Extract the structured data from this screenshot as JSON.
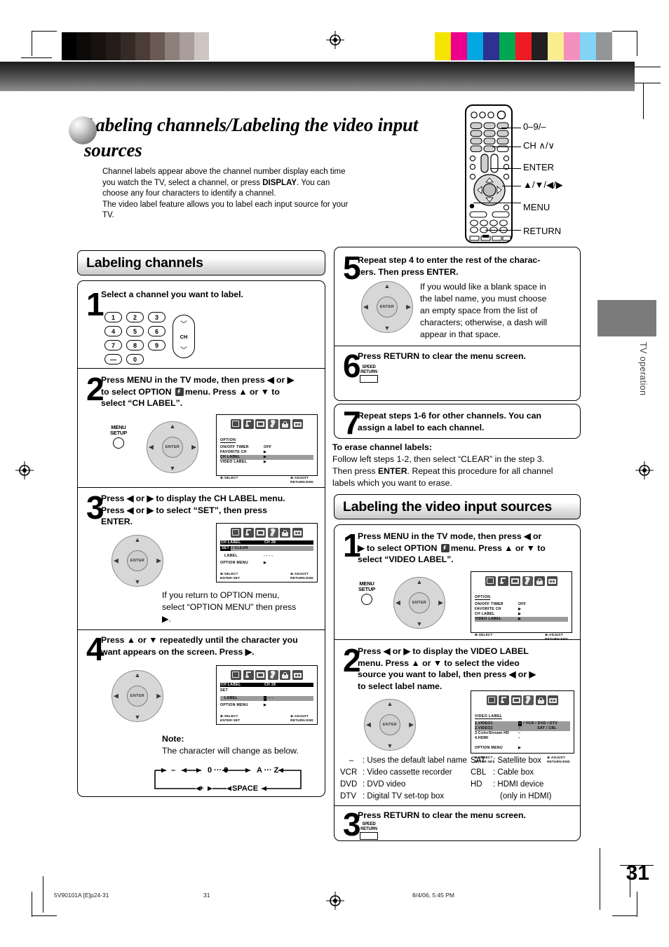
{
  "header": {
    "title": "Labeling channels/Labeling the video input sources",
    "intro_line1": "Channel labels appear above the channel number display each time",
    "intro_line2_a": "you watch the TV, select a channel, or press ",
    "intro_line2_b": "DISPLAY",
    "intro_line2_c": ". You can",
    "intro_line3": "choose any four characters to identify a channel.",
    "intro_line4": "The video label feature allows you to label each input source for your",
    "intro_line5": "TV."
  },
  "remote": {
    "callouts": [
      {
        "label": "0–9/–"
      },
      {
        "label": "CH  ∧/∨"
      },
      {
        "label": "ENTER"
      },
      {
        "label": "▲/▼/◀/▶"
      },
      {
        "label": "MENU"
      },
      {
        "label": "RETURN"
      }
    ]
  },
  "sections": {
    "labeling_channels": "Labeling channels",
    "labeling_video": "Labeling the video input sources"
  },
  "keypad": {
    "keys": [
      "1",
      "2",
      "3",
      "4",
      "5",
      "6",
      "7",
      "8",
      "9",
      "—",
      "0"
    ],
    "ch_label": "CH"
  },
  "buttons": {
    "menu_line1": "MENU",
    "menu_line2": "SETUP",
    "enter": "ENTER",
    "return_line1": "SPEED",
    "return_line2": "RETURN"
  },
  "steps_channels": [
    {
      "num": "1",
      "text": "Select a channel you want to label."
    },
    {
      "num": "2",
      "line1": "Press MENU in the TV mode, then press ◀ or ▶",
      "line2_a": "to select OPTION ",
      "line2_b": "menu. Press ▲ or ▼ to",
      "line3": "select “CH LABEL”."
    },
    {
      "num": "3",
      "line1": "Press ◀ or ▶ to display the CH LABEL menu.",
      "line2": "Press ◀ or ▶ to select “SET”, then press",
      "line3": "ENTER.",
      "note1": "If you return to OPTION menu,",
      "note2": "select “OPTION MENU” then press",
      "note3": "▶."
    },
    {
      "num": "4",
      "line1": "Press ▲ or ▼ repeatedly until the character you",
      "line2": "want appears on the screen. Press ▶.",
      "note_title": "Note:",
      "note_body": "The character will change as below.",
      "cycle": [
        "–",
        "0 ··· 9",
        "A ··· Z",
        "+",
        "SPACE"
      ]
    },
    {
      "num": "5",
      "line1": "Repeat step 4 to enter the rest of the charac-",
      "line2": "ters. Then press ENTER.",
      "body1": "If you would like a blank space in",
      "body2": "the label name, you must choose",
      "body3": "an empty space from the list of",
      "body4": "characters; otherwise, a dash will",
      "body5": "appear in that space."
    },
    {
      "num": "6",
      "text": "Press RETURN to clear the menu screen."
    },
    {
      "num": "7",
      "line1": "Repeat steps 1-6 for other channels. You can",
      "line2": "assign a label to each channel."
    }
  ],
  "erase_note": {
    "title": "To erase channel labels:",
    "line1": "Follow left steps 1-2, then select “CLEAR” in the step 3.",
    "line2_a": "Then press ",
    "line2_b": "ENTER",
    "line2_c": ". Repeat this procedure for all channel",
    "line3": "labels which you want to erase."
  },
  "steps_video": [
    {
      "num": "1",
      "line1": "Press MENU in the TV mode, then press ◀ or",
      "line2_a": "▶ to select OPTION ",
      "line2_b": "menu. Press ▲ or ▼ to",
      "line3": "select “VIDEO LABEL”."
    },
    {
      "num": "2",
      "line1": "Press ◀ or ▶ to display the VIDEO LABEL",
      "line2": "menu. Press ▲ or ▼ to select the video",
      "line3": "source you want to label, then press ◀ or ▶",
      "line4": "to select label name."
    },
    {
      "num": "3",
      "text": "Press RETURN to clear the menu screen."
    }
  ],
  "legend": {
    "left": [
      {
        "abbr": "–",
        "desc": ": Uses the default label name"
      },
      {
        "abbr": "VCR",
        "desc": ": Video cassette recorder"
      },
      {
        "abbr": "DVD",
        "desc": ": DVD video"
      },
      {
        "abbr": "DTV",
        "desc": ": Digital TV set-top box"
      }
    ],
    "right": [
      {
        "abbr": "SAT",
        "desc": ": Satellite box"
      },
      {
        "abbr": "CBL",
        "desc": ": Cable box"
      },
      {
        "abbr": "HD",
        "desc": ": HDMI device"
      },
      {
        "abbr": "",
        "desc": "(only in HDMI)"
      }
    ]
  },
  "osd": {
    "option_menu": {
      "title": "OPTION",
      "rows": [
        {
          "name": "ON/OFF TIMER",
          "value": "OFF"
        },
        {
          "name": "FAVORITE CH",
          "value": "▶"
        },
        {
          "name": "CH LABEL",
          "value": "▶"
        },
        {
          "name": "VIDEO LABEL",
          "value": "▶"
        }
      ],
      "foot_left": "⊕:SELECT",
      "foot_right_1": "⊛:ADJUST",
      "foot_right_2": "RETURN:END"
    },
    "ch_label_set": {
      "header_name": "CH LABEL",
      "header_value": "CH  28",
      "row_set": "SET",
      "row_clear": "/ CLEAR",
      "row_label_name": "LABEL",
      "row_label_value": "- - - -",
      "row_option": "OPTION MENU",
      "row_option_value": "▶",
      "foot_left_1": "⊕:SELECT",
      "foot_left_2": "ENTER:SET",
      "foot_right_1": "⊛:ADJUST",
      "foot_right_2": "RETURN:END"
    },
    "video_label": {
      "title": "VIDEO LABEL",
      "rows": [
        {
          "name": "1.VIDEO1",
          "value": "–"
        },
        {
          "name": "2.VIDEO2",
          "value": "–"
        },
        {
          "name": "3.ColorStream    HD",
          "value": "–"
        },
        {
          "name": "4.HDMI",
          "value": "–"
        }
      ],
      "options_line1": "/ VCR / DVD / DTV",
      "options_line2": "SAT / CBL",
      "row_option": "OPTION MENU",
      "row_option_value": "▶",
      "foot_left_1": "⊕:SELECT",
      "foot_left_2": "ENTER:SET",
      "foot_right_1": "⊛:ADJUST",
      "foot_right_2": "RETURN:END"
    }
  },
  "sidebar": {
    "tab_label": "TV operation"
  },
  "footer": {
    "page_number": "31",
    "doc_id": "5V90101A [E]p24-31",
    "folio": "31",
    "timestamp": "8/4/06, 5:45 PM"
  },
  "calibration": {
    "gray_ramp": [
      "#000000",
      "#0d0a0a",
      "#17110f",
      "#241c19",
      "#352b26",
      "#4a3d37",
      "#6b5a53",
      "#8d7f79",
      "#a99e99",
      "#cdc5c1",
      "#ffffff"
    ],
    "colors": [
      "#f5e400",
      "#ec008c",
      "#00a7e1",
      "#2e3192",
      "#00a651",
      "#ed1c24",
      "#231f20",
      "#f9ed8f",
      "#f48fc0",
      "#81d4f5",
      "#939598"
    ]
  }
}
